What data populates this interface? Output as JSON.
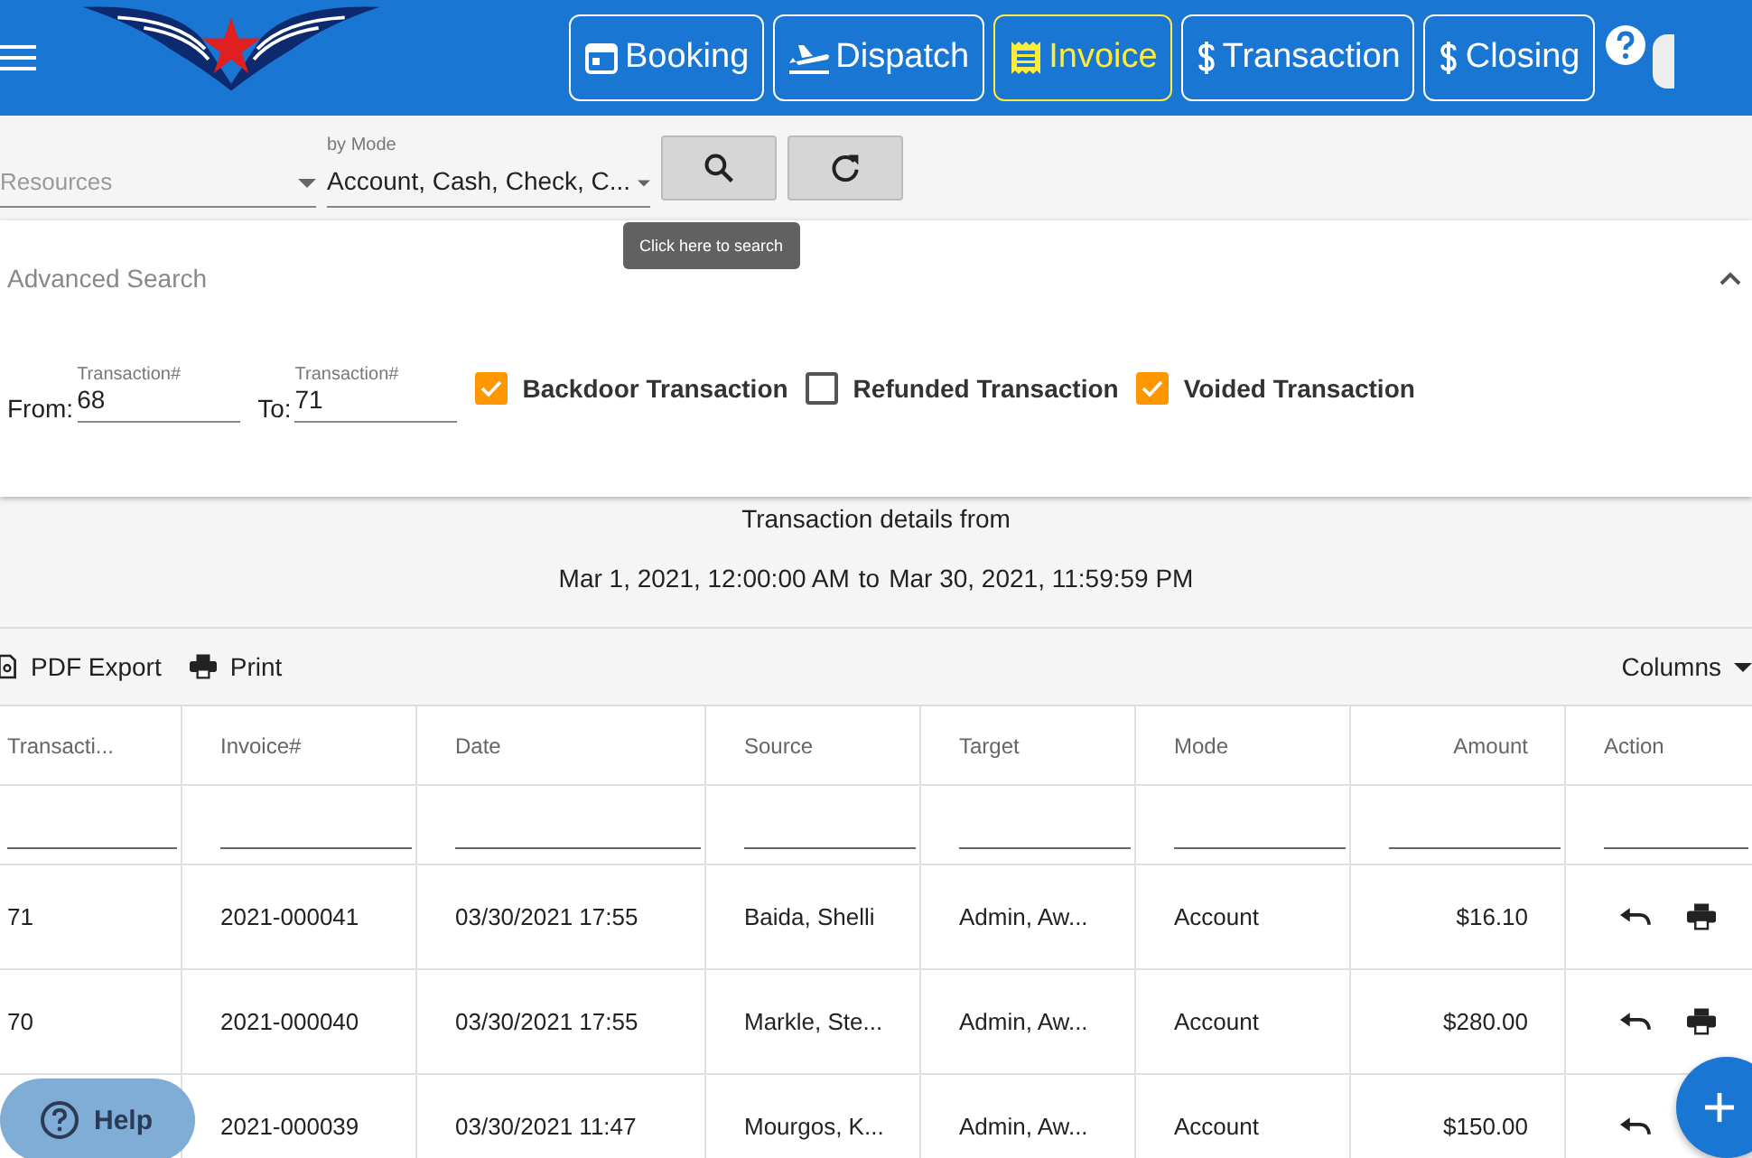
{
  "nav": {
    "tabs": [
      {
        "label": "Booking",
        "selected": false
      },
      {
        "label": "Dispatch",
        "selected": false
      },
      {
        "label": "Invoice",
        "selected": true
      },
      {
        "label": "Transaction",
        "selected": false
      },
      {
        "label": "Closing",
        "selected": false
      }
    ]
  },
  "filters": {
    "resources": {
      "placeholder": "Resources"
    },
    "mode": {
      "label": "by Mode",
      "value": "Account, Cash, Check, C..."
    },
    "tooltip": "Click here to search"
  },
  "advanced_search": {
    "title": "Advanced Search",
    "expanded": true,
    "from": {
      "prefix": "From:",
      "label": "Transaction#",
      "value": "68"
    },
    "to": {
      "prefix": "To:",
      "label": "Transaction#",
      "value": "71"
    },
    "checkboxes": [
      {
        "label": "Backdoor Transaction",
        "checked": true
      },
      {
        "label": "Refunded Transaction",
        "checked": false
      },
      {
        "label": "Voided Transaction",
        "checked": true
      }
    ]
  },
  "summary": {
    "title": "Transaction details from",
    "start": "Mar 1, 2021, 12:00:00 AM",
    "joiner": "to",
    "end": "Mar 30, 2021, 11:59:59 PM"
  },
  "toolbar": {
    "pdf_export": "PDF Export",
    "print": "Print",
    "columns": "Columns"
  },
  "table": {
    "columns": [
      {
        "label": "Transacti..."
      },
      {
        "label": "Invoice#"
      },
      {
        "label": "Date"
      },
      {
        "label": "Source"
      },
      {
        "label": "Target"
      },
      {
        "label": "Mode"
      },
      {
        "label": "Amount"
      },
      {
        "label": "Action"
      }
    ],
    "rows": [
      {
        "cells": [
          "71",
          "2021-000041",
          "03/30/2021 17:55",
          "Baida, Shelli",
          "Admin, Aw...",
          "Account",
          "$16.10"
        ]
      },
      {
        "cells": [
          "70",
          "2021-000040",
          "03/30/2021 17:55",
          "Markle, Ste...",
          "Admin, Aw...",
          "Account",
          "$280.00"
        ]
      },
      {
        "cells": [
          null,
          "2021-000039",
          "03/30/2021 11:47",
          "Mourgos, K...",
          "Admin, Aw...",
          "Account",
          "$150.00"
        ]
      }
    ]
  },
  "help_button": "Help"
}
